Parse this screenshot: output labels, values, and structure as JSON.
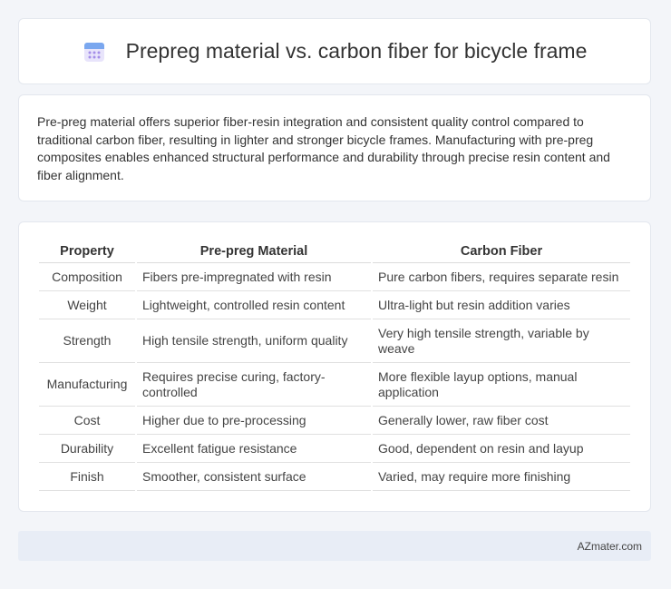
{
  "header": {
    "title": "Prepreg material vs. carbon fiber for bicycle frame",
    "icon": "calendar-icon"
  },
  "summary": {
    "text": "Pre-preg material offers superior fiber-resin integration and consistent quality control compared to traditional carbon fiber, resulting in lighter and stronger bicycle frames. Manufacturing with pre-preg composites enables enhanced structural performance and durability through precise resin content and fiber alignment."
  },
  "table": {
    "headers": [
      "Property",
      "Pre-preg Material",
      "Carbon Fiber"
    ],
    "rows": [
      [
        "Composition",
        "Fibers pre-impregnated with resin",
        "Pure carbon fibers, requires separate resin"
      ],
      [
        "Weight",
        "Lightweight, controlled resin content",
        "Ultra-light but resin addition varies"
      ],
      [
        "Strength",
        "High tensile strength, uniform quality",
        "Very high tensile strength, variable by weave"
      ],
      [
        "Manufacturing",
        "Requires precise curing, factory-controlled",
        "More flexible layup options, manual application"
      ],
      [
        "Cost",
        "Higher due to pre-processing",
        "Generally lower, raw fiber cost"
      ],
      [
        "Durability",
        "Excellent fatigue resistance",
        "Good, dependent on resin and layup"
      ],
      [
        "Finish",
        "Smoother, consistent surface",
        "Varied, may require more finishing"
      ]
    ]
  },
  "footer": {
    "brand": "AZmater.com"
  }
}
